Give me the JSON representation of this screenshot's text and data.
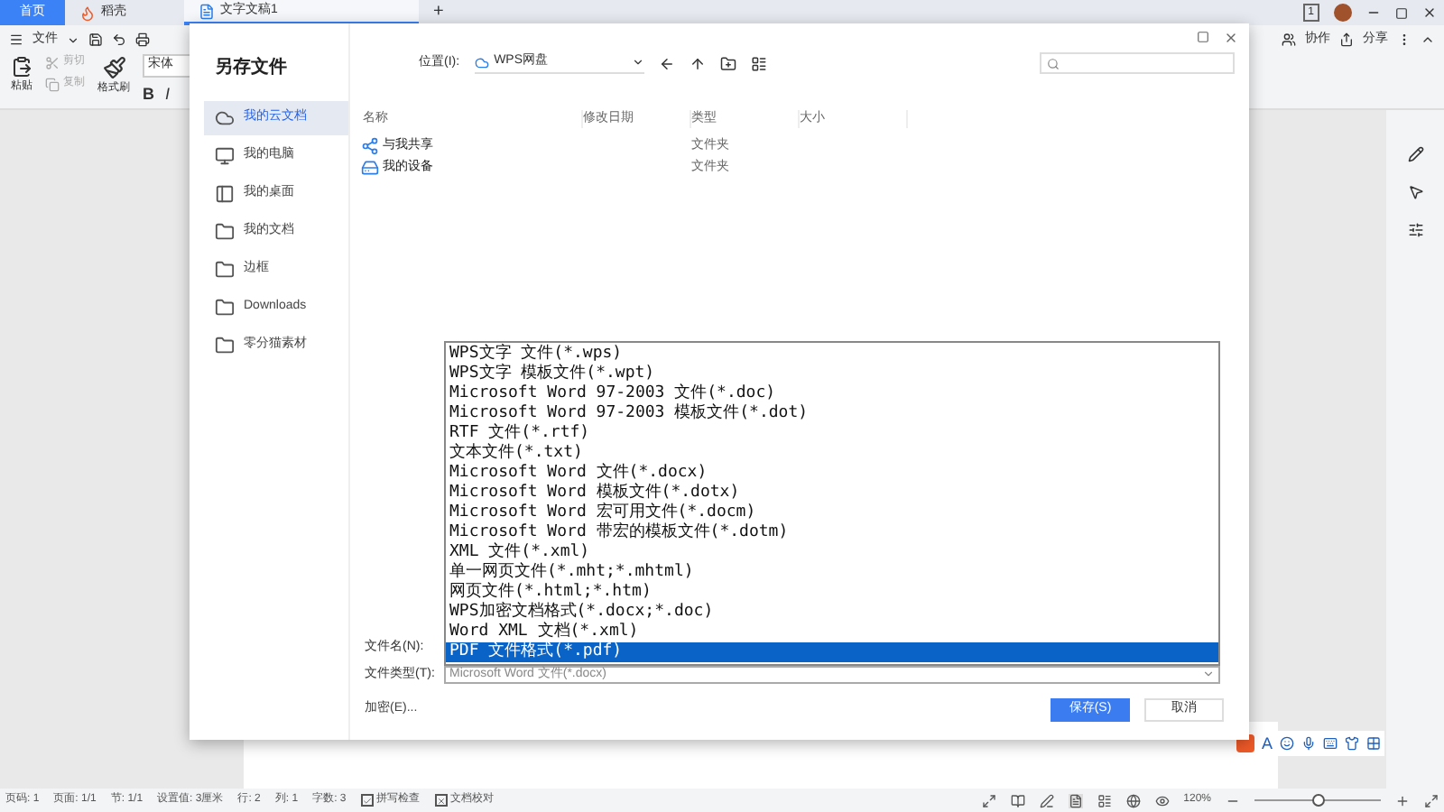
{
  "app_tabs": [
    {
      "label": "首页",
      "selected": false,
      "kind": "home"
    },
    {
      "label": "稻壳",
      "selected": false,
      "kind": "docer"
    },
    {
      "label": "文字文稿1",
      "selected": true,
      "kind": "doc"
    }
  ],
  "new_tab": "+",
  "page_count": "1",
  "menu": {
    "label": "文件"
  },
  "ribbon": {
    "paste": "粘贴",
    "cut": {
      "label": "剪切",
      "disabled": true
    },
    "copy": {
      "label": "复制",
      "disabled": true
    },
    "format_painter": "格式刷",
    "font": "宋体",
    "bold": "B",
    "italic": "I"
  },
  "header_actions": [
    "协作",
    "分享"
  ],
  "dialog": {
    "title": "另存文件",
    "location_label": "位置(I):",
    "location": "WPS网盘",
    "sidebar": [
      {
        "label": "我的云文档",
        "selected": true,
        "kind": "cloud"
      },
      {
        "label": "我的电脑",
        "selected": false,
        "kind": "computer"
      },
      {
        "label": "我的桌面",
        "selected": false,
        "kind": "desktop"
      },
      {
        "label": "我的文档",
        "selected": false,
        "kind": "folder"
      },
      {
        "label": "边框",
        "selected": false,
        "kind": "folder"
      },
      {
        "label": "Downloads",
        "selected": false,
        "kind": "folder"
      },
      {
        "label": "零分猫素材",
        "selected": false,
        "kind": "folder"
      }
    ],
    "columns": [
      "名称",
      "修改日期",
      "类型",
      "大小"
    ],
    "rows": [
      {
        "name": "与我共享",
        "type": "文件夹",
        "kind": "shared"
      },
      {
        "name": "我的设备",
        "type": "文件夹",
        "kind": "device"
      }
    ],
    "filename_label": "文件名(N):",
    "filetype_label": "文件类型(T):",
    "filetype_value": "Microsoft Word 文件(*.docx)",
    "filetype_options": [
      {
        "label": "WPS文字 文件(*.wps)",
        "selected": false
      },
      {
        "label": "WPS文字 模板文件(*.wpt)",
        "selected": false
      },
      {
        "label": "Microsoft Word 97-2003 文件(*.doc)",
        "selected": false
      },
      {
        "label": "Microsoft Word 97-2003 模板文件(*.dot)",
        "selected": false
      },
      {
        "label": "RTF 文件(*.rtf)",
        "selected": false
      },
      {
        "label": "文本文件(*.txt)",
        "selected": false
      },
      {
        "label": "Microsoft Word 文件(*.docx)",
        "selected": false
      },
      {
        "label": "Microsoft Word 模板文件(*.dotx)",
        "selected": false
      },
      {
        "label": "Microsoft Word 宏可用文件(*.docm)",
        "selected": false
      },
      {
        "label": "Microsoft Word 带宏的模板文件(*.dotm)",
        "selected": false
      },
      {
        "label": "XML 文件(*.xml)",
        "selected": false
      },
      {
        "label": "单一网页文件(*.mht;*.mhtml)",
        "selected": false
      },
      {
        "label": "网页文件(*.html;*.htm)",
        "selected": false
      },
      {
        "label": "WPS加密文档格式(*.docx;*.doc)",
        "selected": false
      },
      {
        "label": "Word XML 文档(*.xml)",
        "selected": false
      },
      {
        "label": "PDF 文件格式(*.pdf)",
        "selected": true
      }
    ],
    "encrypt": "加密(E)...",
    "save": "保存(S)",
    "cancel": "取消"
  },
  "status_bar": {
    "items": [
      "页码: 1",
      "页面: 1/1",
      "节: 1/1",
      "设置值: 3厘米",
      "行: 2",
      "列: 1",
      "字数: 3"
    ],
    "checks": [
      {
        "label": "拼写检查",
        "kind": "tick"
      },
      {
        "label": "文档校对",
        "kind": "cross"
      }
    ],
    "zoom": "120%",
    "zoom_slider": {
      "level": 0.5
    }
  },
  "ime_toolbar": {
    "label": "A"
  }
}
